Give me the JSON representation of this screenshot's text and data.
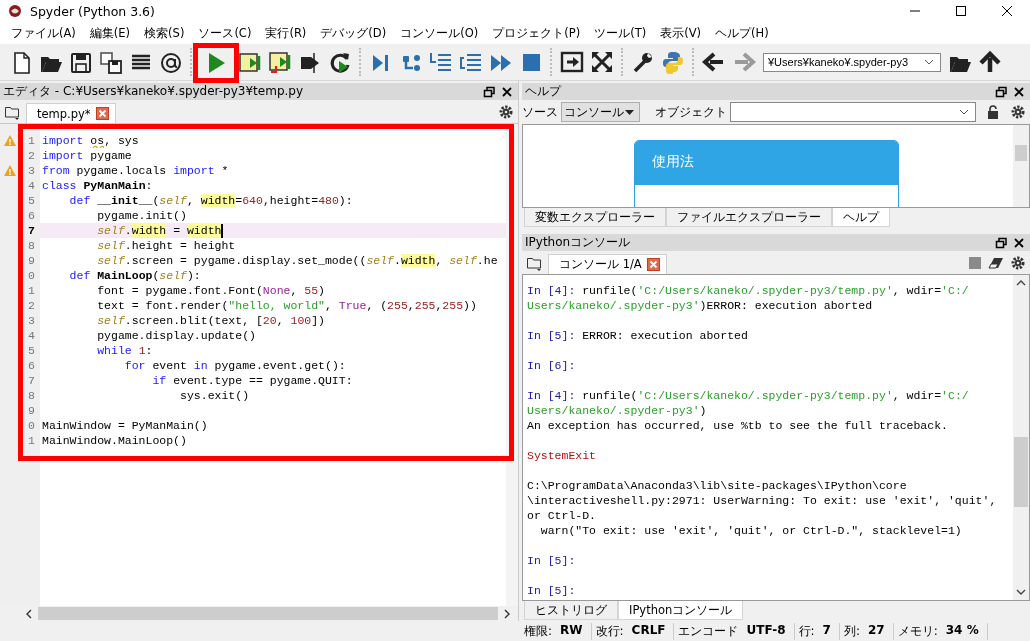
{
  "window": {
    "title": "Spyder (Python 3.6)"
  },
  "menu": [
    {
      "label": "ファイル(A)"
    },
    {
      "label": "編集(E)"
    },
    {
      "label": "検索(S)"
    },
    {
      "label": "ソース(C)"
    },
    {
      "label": "実行(R)"
    },
    {
      "label": "デバッグ(D)"
    },
    {
      "label": "コンソール(O)"
    },
    {
      "label": "プロジェクト(P)"
    },
    {
      "label": "ツール(T)"
    },
    {
      "label": "表示(V)"
    },
    {
      "label": "ヘルプ(H)"
    }
  ],
  "toolbar": [
    {
      "kind": "new-file"
    },
    {
      "kind": "open"
    },
    {
      "kind": "save"
    },
    {
      "kind": "save-all"
    },
    {
      "kind": "list"
    },
    {
      "kind": "at"
    },
    {
      "kind": "sep"
    },
    {
      "kind": "run",
      "highlighted": true
    },
    {
      "kind": "run-cell"
    },
    {
      "kind": "run-cell-advance"
    },
    {
      "kind": "run-selection"
    },
    {
      "kind": "rerun"
    },
    {
      "kind": "sep"
    },
    {
      "kind": "debug"
    },
    {
      "kind": "step"
    },
    {
      "kind": "step-in"
    },
    {
      "kind": "step-out"
    },
    {
      "kind": "continue"
    },
    {
      "kind": "stop"
    },
    {
      "kind": "sep"
    },
    {
      "kind": "maximize"
    },
    {
      "kind": "fullscreen"
    },
    {
      "kind": "sep"
    },
    {
      "kind": "wrench"
    },
    {
      "kind": "python"
    },
    {
      "kind": "sep"
    },
    {
      "kind": "back"
    },
    {
      "kind": "forward",
      "disabled": true
    },
    {
      "kind": "path",
      "value": "¥Users¥kaneko¥.spyder-py3"
    },
    {
      "kind": "open"
    },
    {
      "kind": "up"
    }
  ],
  "editor": {
    "title": "エディタ - C:¥Users¥kaneko¥.spyder-py3¥temp.py",
    "highlighted": true,
    "tabs": [
      {
        "label": "temp.py*",
        "selected": true
      }
    ],
    "lines": [
      {
        "number": "1",
        "warning": true,
        "current": false,
        "segments": [
          {
            "kind": "kw",
            "t": "import "
          },
          {
            "kind": "warn",
            "t": "os"
          },
          {
            "kind": "p",
            "t": ", sys"
          }
        ]
      },
      {
        "number": "2",
        "warning": false,
        "current": false,
        "segments": [
          {
            "kind": "kw",
            "t": "import"
          },
          {
            "kind": "p",
            "t": " pygame"
          }
        ]
      },
      {
        "number": "3",
        "warning": true,
        "current": false,
        "segments": [
          {
            "kind": "kw",
            "t": "from"
          },
          {
            "kind": "p",
            "t": " pygame.locals "
          },
          {
            "kind": "kw",
            "t": "import"
          },
          {
            "kind": "p",
            "t": " *"
          }
        ]
      },
      {
        "number": "4",
        "warning": false,
        "current": false,
        "segments": [
          {
            "kind": "kw",
            "t": "class "
          },
          {
            "kind": "def",
            "t": "PyManMain"
          },
          {
            "kind": "p",
            "t": ":"
          }
        ]
      },
      {
        "number": "5",
        "warning": false,
        "current": false,
        "segments": [
          {
            "kind": "kw",
            "t": "    def "
          },
          {
            "kind": "def",
            "t": "__init__"
          },
          {
            "kind": "p",
            "t": "("
          },
          {
            "kind": "self",
            "t": "self"
          },
          {
            "kind": "p",
            "t": ", "
          },
          {
            "kind": "hl",
            "t": "width"
          },
          {
            "kind": "p",
            "t": "="
          },
          {
            "kind": "num",
            "t": "640"
          },
          {
            "kind": "p",
            "t": ",height="
          },
          {
            "kind": "num",
            "t": "480"
          },
          {
            "kind": "p",
            "t": "):"
          }
        ]
      },
      {
        "number": "6",
        "warning": false,
        "current": false,
        "segments": [
          {
            "kind": "p",
            "t": "        pygame.init()"
          }
        ]
      },
      {
        "number": "7",
        "warning": false,
        "current": true,
        "segments": [
          {
            "kind": "self",
            "t": "        self"
          },
          {
            "kind": "p",
            "t": "."
          },
          {
            "kind": "hl",
            "t": "width"
          },
          {
            "kind": "p",
            "t": " = "
          },
          {
            "kind": "hl",
            "t": "width"
          }
        ]
      },
      {
        "number": "8",
        "warning": false,
        "current": false,
        "segments": [
          {
            "kind": "self",
            "t": "        self"
          },
          {
            "kind": "p",
            "t": ".height = height"
          }
        ]
      },
      {
        "number": "9",
        "warning": false,
        "current": false,
        "segments": [
          {
            "kind": "self",
            "t": "        self"
          },
          {
            "kind": "p",
            "t": ".screen = pygame.display.set_mode(("
          },
          {
            "kind": "self",
            "t": "self"
          },
          {
            "kind": "p",
            "t": "."
          },
          {
            "kind": "hl",
            "t": "width"
          },
          {
            "kind": "p",
            "t": ", "
          },
          {
            "kind": "self",
            "t": "self"
          },
          {
            "kind": "p",
            "t": ".he"
          }
        ]
      },
      {
        "number": "0",
        "warning": false,
        "current": false,
        "segments": [
          {
            "kind": "kw",
            "t": "    def "
          },
          {
            "kind": "def",
            "t": "MainLoop"
          },
          {
            "kind": "p",
            "t": "("
          },
          {
            "kind": "self",
            "t": "self"
          },
          {
            "kind": "p",
            "t": "):"
          }
        ]
      },
      {
        "number": "1",
        "warning": false,
        "current": false,
        "segments": [
          {
            "kind": "p",
            "t": "        font = pygame.font.Font("
          },
          {
            "kind": "bi",
            "t": "None"
          },
          {
            "kind": "p",
            "t": ", "
          },
          {
            "kind": "num",
            "t": "55"
          },
          {
            "kind": "p",
            "t": ")"
          }
        ]
      },
      {
        "number": "2",
        "warning": false,
        "current": false,
        "segments": [
          {
            "kind": "p",
            "t": "        text = font.render("
          },
          {
            "kind": "str",
            "t": "\"hello, world\""
          },
          {
            "kind": "p",
            "t": ", "
          },
          {
            "kind": "bi",
            "t": "True"
          },
          {
            "kind": "p",
            "t": ", ("
          },
          {
            "kind": "num",
            "t": "255"
          },
          {
            "kind": "p",
            "t": ","
          },
          {
            "kind": "num",
            "t": "255"
          },
          {
            "kind": "p",
            "t": ","
          },
          {
            "kind": "num",
            "t": "255"
          },
          {
            "kind": "p",
            "t": "))"
          }
        ]
      },
      {
        "number": "3",
        "warning": false,
        "current": false,
        "segments": [
          {
            "kind": "self",
            "t": "        self"
          },
          {
            "kind": "p",
            "t": ".screen.blit(text, ["
          },
          {
            "kind": "num",
            "t": "20"
          },
          {
            "kind": "p",
            "t": ", "
          },
          {
            "kind": "num",
            "t": "100"
          },
          {
            "kind": "p",
            "t": "])"
          }
        ]
      },
      {
        "number": "4",
        "warning": false,
        "current": false,
        "segments": [
          {
            "kind": "p",
            "t": "        pygame.display.update()"
          }
        ]
      },
      {
        "number": "5",
        "warning": false,
        "current": false,
        "segments": [
          {
            "kind": "kw",
            "t": "        while "
          },
          {
            "kind": "num",
            "t": "1"
          },
          {
            "kind": "p",
            "t": ":"
          }
        ]
      },
      {
        "number": "6",
        "warning": false,
        "current": false,
        "segments": [
          {
            "kind": "kw",
            "t": "            for"
          },
          {
            "kind": "p",
            "t": " event "
          },
          {
            "kind": "kw",
            "t": "in"
          },
          {
            "kind": "p",
            "t": " pygame.event.get():"
          }
        ]
      },
      {
        "number": "7",
        "warning": false,
        "current": false,
        "segments": [
          {
            "kind": "kw",
            "t": "                if"
          },
          {
            "kind": "p",
            "t": " event.type == pygame.QUIT:"
          }
        ]
      },
      {
        "number": "8",
        "warning": false,
        "current": false,
        "segments": [
          {
            "kind": "p",
            "t": "                    sys.exit()"
          }
        ]
      },
      {
        "number": "9",
        "warning": false,
        "current": false
      },
      {
        "number": "0",
        "warning": false,
        "current": false,
        "segments": [
          {
            "kind": "p",
            "t": "MainWindow = PyManMain()"
          }
        ]
      },
      {
        "number": "1",
        "warning": false,
        "current": false,
        "segments": [
          {
            "kind": "p",
            "t": "MainWindow.MainLoop()"
          }
        ]
      }
    ]
  },
  "help": {
    "title": "ヘルプ",
    "source_label": "ソース",
    "source_value": "コンソール",
    "object_label": "オブジェクト",
    "card_title": "使用法",
    "tabs": [
      {
        "label": "変数エクスプローラー",
        "selected": false
      },
      {
        "label": "ファイルエクスプローラー",
        "selected": false
      },
      {
        "label": "ヘルプ",
        "selected": true
      }
    ]
  },
  "console": {
    "title": "IPythonコンソール",
    "tabs": [
      {
        "label": "コンソール 1/A",
        "selected": true
      }
    ],
    "blocks": [
      [
        [
          {
            "kind": "prompt",
            "t": "In [4]:"
          },
          {
            "kind": "p",
            "t": " runfile("
          },
          {
            "kind": "str",
            "t": "'C:/Users/kaneko/.spyder-py3/temp.py'"
          },
          {
            "kind": "p",
            "t": ", wdir="
          },
          {
            "kind": "str",
            "t": "'C:/"
          }
        ],
        [
          {
            "kind": "str",
            "t": "Users/kaneko/.spyder-py3'"
          },
          {
            "kind": "p",
            "t": ")ERROR: execution aborted"
          }
        ]
      ],
      [
        [
          {
            "kind": "prompt",
            "t": "In [5]:"
          },
          {
            "kind": "p",
            "t": " ERROR: execution aborted"
          }
        ]
      ],
      [
        [
          {
            "kind": "prompt",
            "t": "In [6]:"
          }
        ]
      ],
      [
        [
          {
            "kind": "prompt",
            "t": "In [4]:"
          },
          {
            "kind": "p",
            "t": " runfile("
          },
          {
            "kind": "str",
            "t": "'C:/Users/kaneko/.spyder-py3/temp.py'"
          },
          {
            "kind": "p",
            "t": ", wdir="
          },
          {
            "kind": "str",
            "t": "'C:/"
          }
        ],
        [
          {
            "kind": "str",
            "t": "Users/kaneko/.spyder-py3'"
          },
          {
            "kind": "p",
            "t": ")"
          }
        ],
        [
          {
            "kind": "p",
            "t": "An exception has occurred, use %tb to see the full traceback."
          }
        ]
      ],
      [
        [
          {
            "kind": "err",
            "t": "SystemExit"
          }
        ]
      ],
      [
        [
          {
            "kind": "p",
            "t": "C:\\ProgramData\\Anaconda3\\lib\\site-packages\\IPython\\core"
          }
        ],
        [
          {
            "kind": "p",
            "t": "\\interactiveshell.py:2971: UserWarning: To exit: use 'exit', 'quit',"
          }
        ],
        [
          {
            "kind": "p",
            "t": "or Ctrl-D."
          }
        ],
        [
          {
            "kind": "p",
            "t": "  warn(\"To exit: use 'exit', 'quit', or Ctrl-D.\", stacklevel=1)"
          }
        ]
      ],
      [
        [
          {
            "kind": "prompt",
            "t": "In [5]:"
          }
        ]
      ],
      [
        [
          {
            "kind": "prompt",
            "t": "In [5]:"
          }
        ]
      ]
    ],
    "bottom_tabs": [
      {
        "label": "ヒストリログ",
        "selected": false
      },
      {
        "label": "IPythonコンソール",
        "selected": true
      }
    ]
  },
  "status_bar": [
    {
      "label": "権限:",
      "value": "RW"
    },
    {
      "label": "改行:",
      "value": "CRLF"
    },
    {
      "label": "エンコード",
      "value": "UTF-8"
    },
    {
      "label": "行:",
      "value": "7"
    },
    {
      "label": "列:",
      "value": "27"
    },
    {
      "label": "メモリ:",
      "value": "34 %"
    }
  ]
}
